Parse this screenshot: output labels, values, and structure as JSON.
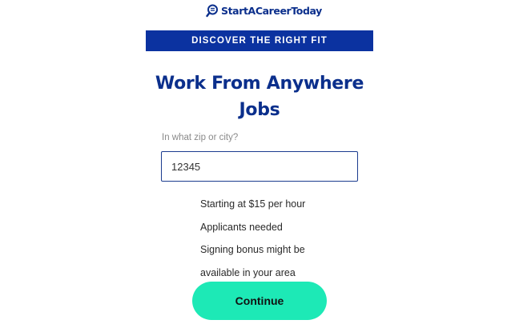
{
  "header": {
    "logo_text": "StartACareerToday",
    "logo_icon": "magnifier-with-lines-icon"
  },
  "banner": {
    "text": "DISCOVER THE RIGHT FIT"
  },
  "main": {
    "title_line1": "Work From Anywhere",
    "title_line2": "Jobs",
    "location_label": "In what zip or city?",
    "location_value": "12345",
    "benefits": [
      "Starting at $15 per hour",
      "Applicants needed",
      "Signing bonus might be",
      "available in your area"
    ],
    "continue_label": "Continue"
  },
  "colors": {
    "brand_blue": "#0b32a0",
    "title_blue": "#0b2f8c",
    "cta_green": "#1de9b6"
  }
}
